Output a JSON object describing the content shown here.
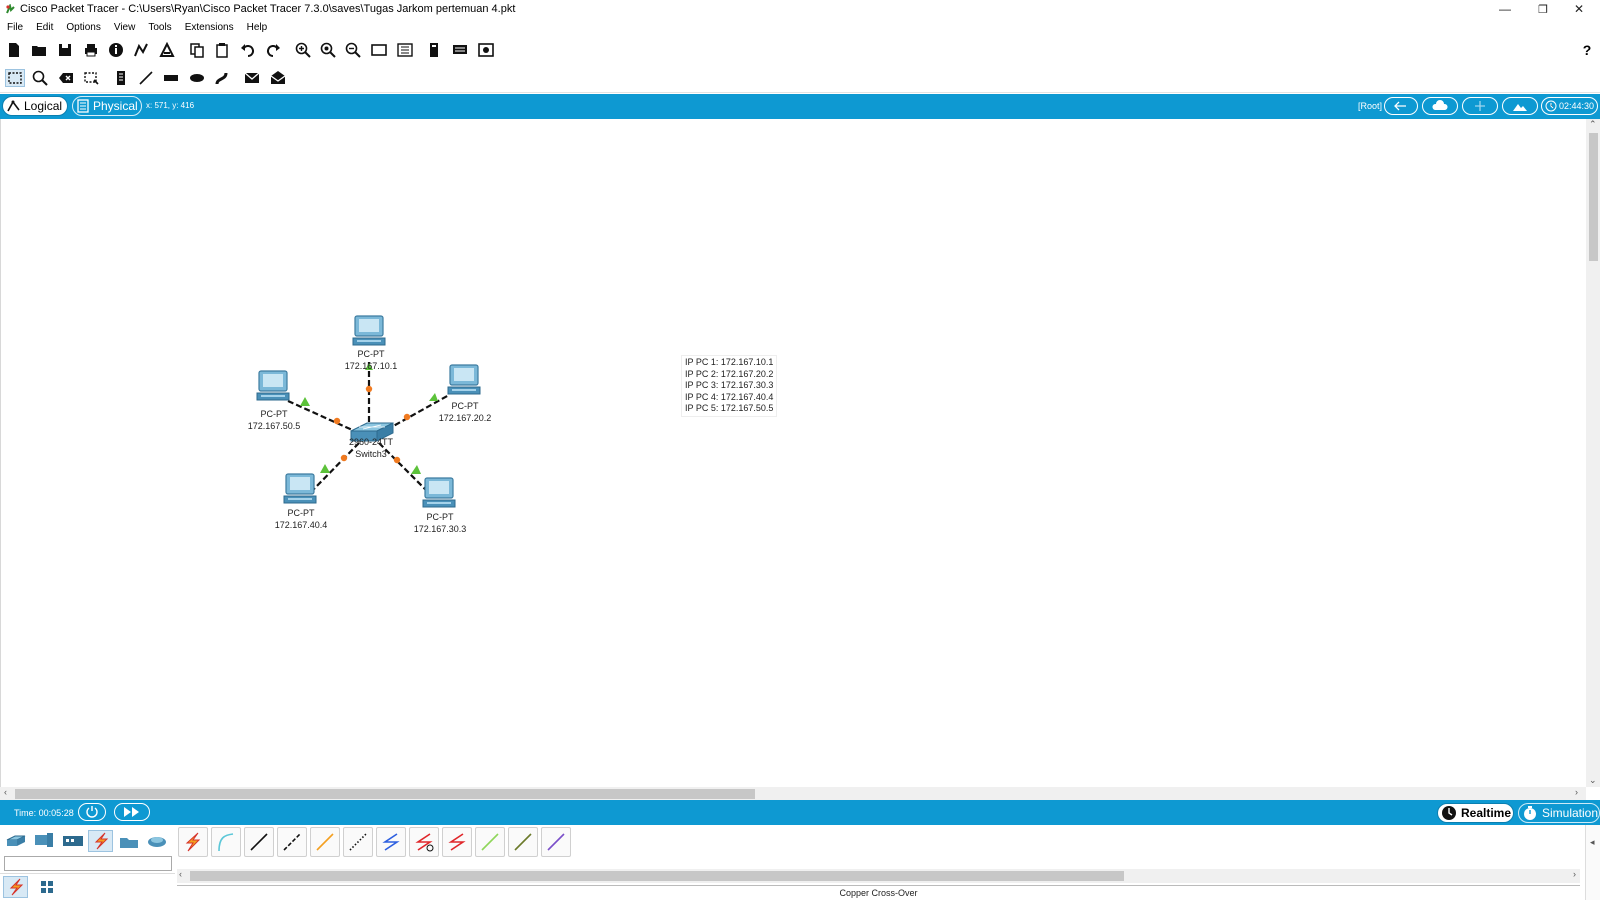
{
  "window": {
    "title": "Cisco Packet Tracer - C:\\Users\\Ryan\\Cisco Packet Tracer 7.3.0\\saves\\Tugas Jarkom pertemuan 4.pkt",
    "controls": {
      "minimize": "—",
      "maximize": "❐",
      "close": "✕"
    }
  },
  "menu": [
    "File",
    "Edit",
    "Options",
    "View",
    "Tools",
    "Extensions",
    "Help"
  ],
  "workspace": {
    "logical_label": "Logical",
    "physical_label": "Physical",
    "coordinates": "x: 571, y: 416",
    "root_label": "[Root]",
    "clock": "02:44:30"
  },
  "topology": {
    "devices": [
      {
        "id": "pc1",
        "model": "PC-PT",
        "ip": "172.167.10.1"
      },
      {
        "id": "pc2",
        "model": "PC-PT",
        "ip": "172.167.20.2"
      },
      {
        "id": "pc3",
        "model": "PC-PT",
        "ip": "172.167.30.3"
      },
      {
        "id": "pc4",
        "model": "PC-PT",
        "ip": "172.167.40.4"
      },
      {
        "id": "pc5",
        "model": "PC-PT",
        "ip": "172.167.50.5"
      },
      {
        "id": "switch",
        "model": "2960-24TT",
        "name": "Switch3"
      }
    ],
    "note": [
      "IP PC 1: 172.167.10.1",
      "IP PC 2: 172.167.20.2",
      "IP PC 3: 172.167.30.3",
      "IP PC 4: 172.167.40.4",
      "IP PC 5: 172.167.50.5"
    ],
    "colors": {
      "link": "#111111",
      "port_switch": "#f07a20",
      "port_pc": "#5cc23a",
      "device": "#4a90b8"
    }
  },
  "timebar": {
    "time": "Time: 00:05:28",
    "realtime_label": "Realtime",
    "simulation_label": "Simulation"
  },
  "device_panel": {
    "selected_cable": "Copper Cross-Over"
  },
  "colors": {
    "accent": "#0e99d2"
  }
}
